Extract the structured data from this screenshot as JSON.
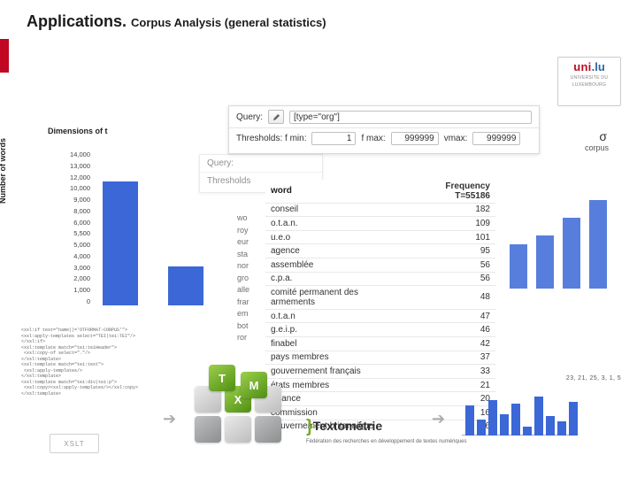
{
  "header": {
    "title": "Applications.",
    "subtitle": "Corpus Analysis (general statistics)"
  },
  "logo": {
    "brand1": "uni",
    "brand2": ".lu",
    "line1": "UNIVERSITE DU",
    "line2": "LUXEMBOURG"
  },
  "panels": {
    "back": {
      "query_label": "Query:",
      "thresholds_label": "Thresholds"
    },
    "topA": {
      "query_label": "Query:",
      "query_value": "[type=\"org\"]",
      "thresh_label": "Thresholds:  f min:",
      "fmin": "1",
      "fmax_label": "f max:",
      "fmax": "999999",
      "vmax_label": "vmax:",
      "vmax": "999999"
    }
  },
  "rightside": {
    "sigma": "σ",
    "corpus": "corpus"
  },
  "dimensions": "Dimensions of t",
  "yticks": [
    "14,000",
    "13,000",
    "12,000",
    "10,000",
    "9,000",
    "8,000",
    "6,000",
    "5,500",
    "5,000",
    "4,000",
    "3,000",
    "2,000",
    "1,000",
    "0"
  ],
  "ylabel": "Number of words",
  "freq_table": {
    "head_word": "word",
    "head_freq": "Frequency T=55186",
    "rows": [
      {
        "w": "conseil",
        "f": "182"
      },
      {
        "w": "o.t.a.n.",
        "f": "109"
      },
      {
        "w": "u.e.o",
        "f": "101"
      },
      {
        "w": "agence",
        "f": "95"
      },
      {
        "w": "assemblée",
        "f": "56"
      },
      {
        "w": "c.p.a.",
        "f": "56"
      },
      {
        "w": "comité permanent des armements",
        "f": "48"
      },
      {
        "w": "o.t.a.n",
        "f": "47"
      },
      {
        "w": "g.e.i.p.",
        "f": "46"
      },
      {
        "w": "finabel",
        "f": "42"
      },
      {
        "w": "pays membres",
        "f": "37"
      },
      {
        "w": "gouvernement français",
        "f": "33"
      },
      {
        "w": "états membres",
        "f": "21"
      },
      {
        "w": "alliance",
        "f": "20"
      },
      {
        "w": "commission",
        "f": "16"
      },
      {
        "w": "gouvernement britannique",
        "f": "16"
      }
    ]
  },
  "peek": [
    "wo",
    "roy",
    "eur",
    "sta",
    "nor",
    "gro",
    "alle",
    "frar",
    "em",
    "bot",
    "ror"
  ],
  "mini_sequence": "23, 21, 25, 3, 1, 5",
  "textometrie": {
    "name": "Textométrie",
    "sub": "Fédération des recherches en développement de textes numériques"
  },
  "xslt": "XSLT",
  "chart_data": [
    {
      "type": "bar",
      "title": "Dimensions of …",
      "ylabel": "Number of words",
      "ylim": [
        0,
        14000
      ],
      "categories": [
        "",
        ""
      ],
      "values": [
        11200,
        3500
      ],
      "note": "partially occluded back chart; categories unreadable"
    },
    {
      "type": "bar",
      "title": "right-side σ / corpus chart (cropped)",
      "categories": [
        "",
        "",
        "",
        ""
      ],
      "values": [
        50,
        60,
        80,
        100
      ],
      "note": "heights are relative estimates; axis values not visible"
    },
    {
      "type": "bar",
      "title": "bottom mini bar chart",
      "categories": [
        "",
        "",
        "",
        "",
        "",
        "",
        "",
        "",
        "",
        ""
      ],
      "values": [
        34,
        18,
        40,
        24,
        36,
        10,
        44,
        22,
        16,
        38
      ],
      "note": "decorative miniature; values are relative estimates"
    },
    {
      "type": "table",
      "title": "word frequency",
      "columns": [
        "word",
        "Frequency T=55186"
      ],
      "rows": [
        [
          "conseil",
          182
        ],
        [
          "o.t.a.n.",
          109
        ],
        [
          "u.e.o",
          101
        ],
        [
          "agence",
          95
        ],
        [
          "assemblée",
          56
        ],
        [
          "c.p.a.",
          56
        ],
        [
          "comité permanent des armements",
          48
        ],
        [
          "o.t.a.n",
          47
        ],
        [
          "g.e.i.p.",
          46
        ],
        [
          "finabel",
          42
        ],
        [
          "pays membres",
          37
        ],
        [
          "gouvernement français",
          33
        ],
        [
          "états membres",
          21
        ],
        [
          "alliance",
          20
        ],
        [
          "commission",
          16
        ],
        [
          "gouvernement britannique",
          16
        ]
      ]
    }
  ]
}
